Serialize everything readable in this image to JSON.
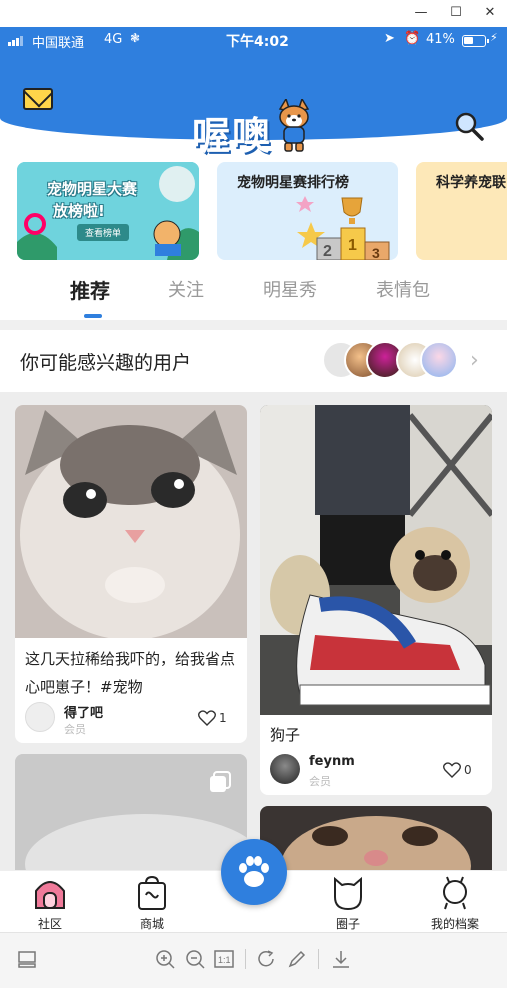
{
  "status_bar": {
    "carrier": "中国联通",
    "network": "4G",
    "time": "下午4:02",
    "battery": "41%"
  },
  "header": {
    "logo_text": "喔噢",
    "mail_icon": "mail-icon",
    "search_icon": "search-icon"
  },
  "banners": [
    {
      "title": "宠物明星大赛",
      "subtitle": "放榜啦!",
      "button": "查看榜单"
    },
    {
      "title": "宠物明星赛排行榜"
    },
    {
      "title": "科学养宠联"
    }
  ],
  "tabs": [
    {
      "label": "推荐",
      "active": true
    },
    {
      "label": "关注"
    },
    {
      "label": "明星秀"
    },
    {
      "label": "表情包"
    }
  ],
  "suggested": {
    "title": "你可能感兴趣的用户"
  },
  "cards": [
    {
      "caption": "这几天拉稀给我吓的，给我省点心吧崽子！#宠物",
      "author": "得了吧",
      "role": "会员",
      "likes": "1"
    },
    {
      "caption": "狗子",
      "author": "feynm",
      "role": "会员",
      "likes": "0"
    }
  ],
  "bottom_nav": [
    {
      "label": "社区",
      "icon": "house-icon"
    },
    {
      "label": "商城",
      "icon": "shopping-bag-icon"
    },
    {
      "label": "",
      "icon": "paw-icon"
    },
    {
      "label": "圈子",
      "icon": "cat-face-icon"
    },
    {
      "label": "我的档案",
      "icon": "profile-icon"
    }
  ],
  "colors": {
    "brand_blue": "#2f7fde",
    "mail_yellow": "#ffd54a",
    "home_pink": "#f07a9a"
  }
}
